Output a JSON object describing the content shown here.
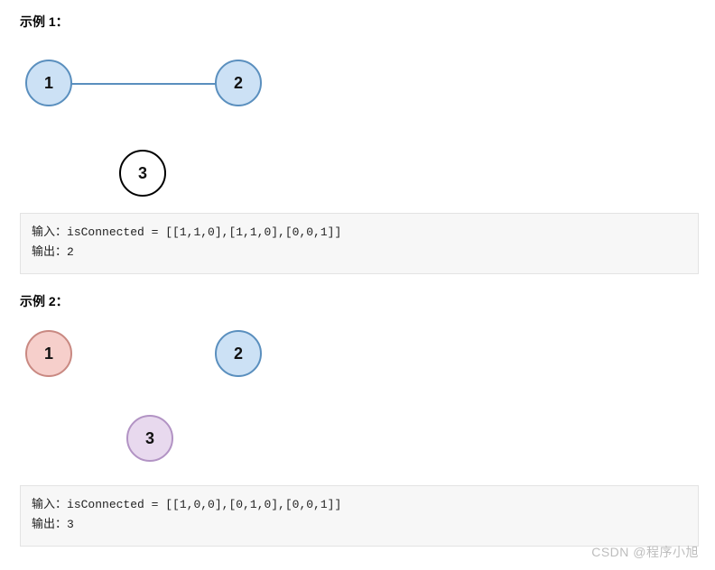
{
  "example1": {
    "title": "示例 1：",
    "nodes": {
      "n1": "1",
      "n2": "2",
      "n3": "3"
    },
    "code": {
      "input_label": "输入：",
      "input_value": "isConnected = [[1,1,0],[1,1,0],[0,0,1]]",
      "output_label": "输出：",
      "output_value": "2"
    }
  },
  "example2": {
    "title": "示例 2：",
    "nodes": {
      "n1": "1",
      "n2": "2",
      "n3": "3"
    },
    "code": {
      "input_label": "输入：",
      "input_value": "isConnected = [[1,0,0],[0,1,0],[0,0,1]]",
      "output_label": "输出：",
      "output_value": "3"
    }
  },
  "watermark": "CSDN @程序小旭"
}
